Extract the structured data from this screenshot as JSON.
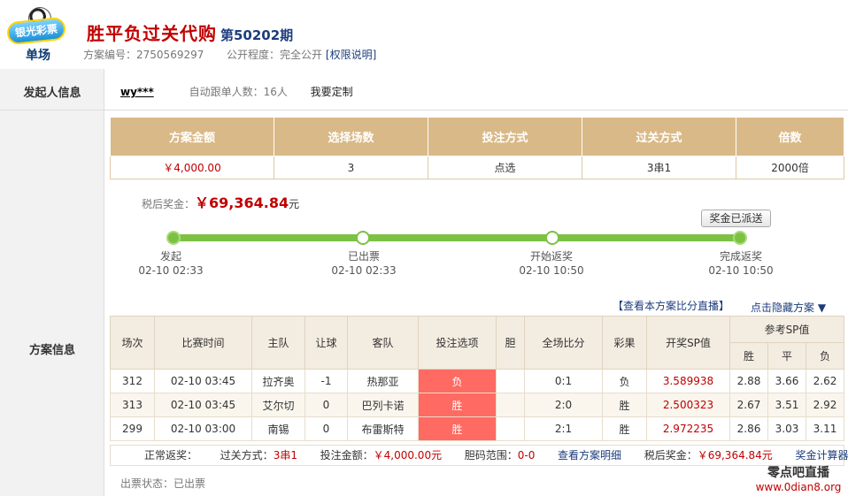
{
  "header": {
    "logo_badge_text": "银光彩票",
    "logo_text": "单场",
    "title": "胜平负过关代购",
    "issue": "第50202期",
    "plan_no_label": "方案编号：",
    "plan_no": "2750569297",
    "public_label": "公开程度：",
    "public_value": "完全公开",
    "permission_link": "[权限说明]"
  },
  "initiator": {
    "section_label": "发起人信息",
    "username": "wy***",
    "auto_follow": "自动跟单人数：16人",
    "custom_link": "我要定制"
  },
  "plan": {
    "section_label": "方案信息",
    "summary_headers": [
      "方案金额",
      "选择场数",
      "投注方式",
      "过关方式",
      "倍数"
    ],
    "summary_values": [
      "￥4,000.00",
      "3",
      "点选",
      "3串1",
      "2000倍"
    ],
    "prize_label": "税后奖金：",
    "prize_amount": "￥69,364.84",
    "prize_unit": "元",
    "sent_button": "奖金已派送",
    "steps": [
      {
        "label": "发起",
        "time": "02-10 02:33"
      },
      {
        "label": "已出票",
        "time": "02-10 02:33"
      },
      {
        "label": "开始返奖",
        "time": "02-10 10:50"
      },
      {
        "label": "完成返奖",
        "time": "02-10 10:50"
      }
    ],
    "live_link": "【查看本方案比分直播】",
    "hide_link": "点击隐藏方案 ▼"
  },
  "detail": {
    "headers": [
      "场次",
      "比赛时间",
      "主队",
      "让球",
      "客队",
      "投注选项",
      "胆",
      "全场比分",
      "彩果",
      "开奖SP值",
      "参考SP值"
    ],
    "sp_sub_headers": [
      "胜",
      "平",
      "负"
    ],
    "rows": [
      {
        "no": "312",
        "time": "02-10 03:45",
        "home": "拉齐奥",
        "handicap": "-1",
        "away": "热那亚",
        "pick": "负",
        "banker": "",
        "score": "0:1",
        "result": "负",
        "sp": "3.589938",
        "ref_w": "2.88",
        "ref_d": "3.66",
        "ref_l": "2.62"
      },
      {
        "no": "313",
        "time": "02-10 03:45",
        "home": "艾尔切",
        "handicap": "0",
        "away": "巴列卡诺",
        "pick": "胜",
        "banker": "",
        "score": "2:0",
        "result": "胜",
        "sp": "2.500323",
        "ref_w": "2.67",
        "ref_d": "3.51",
        "ref_l": "2.92"
      },
      {
        "no": "299",
        "time": "02-10 03:00",
        "home": "南锡",
        "handicap": "0",
        "away": "布雷斯特",
        "pick": "胜",
        "banker": "",
        "score": "2:1",
        "result": "胜",
        "sp": "2.972235",
        "ref_w": "2.86",
        "ref_d": "3.03",
        "ref_l": "3.11"
      }
    ],
    "footer": {
      "normal_prize": "正常返奖：",
      "pass_label": "过关方式：",
      "pass_value": "3串1",
      "amount_label": "投注金额：",
      "amount_value": "￥4,000.00元",
      "banker_label": "胆码范围：",
      "banker_value": "0-0",
      "detail_link": "查看方案明细",
      "prize_label": "税后奖金：",
      "prize_value": "￥69,364.84元",
      "calc_link": "奖金计算器"
    },
    "status": "出票状态：已出票"
  },
  "watermark": {
    "title": "零点吧直播",
    "url": "www.0dian8.org"
  },
  "colors": {
    "title_red": "#c10000",
    "header_gold": "#d9b987",
    "progress_green": "#7dc143",
    "pick_red": "#ff6a62",
    "link_blue": "#1c3d7d"
  }
}
